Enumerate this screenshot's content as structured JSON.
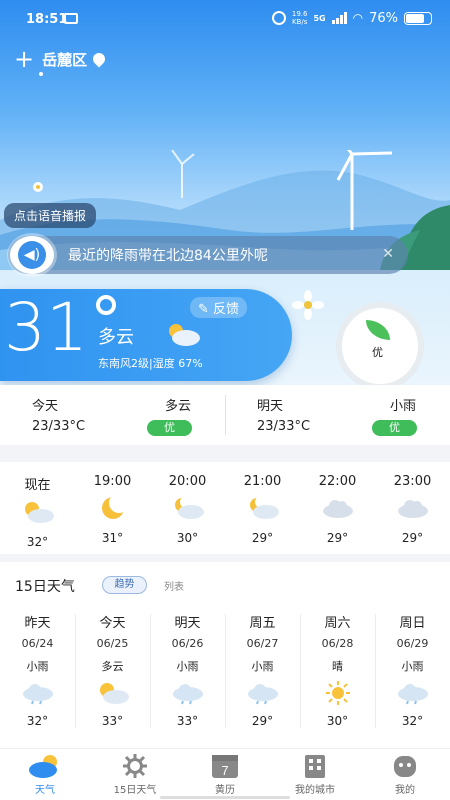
{
  "status": {
    "time": "18:51",
    "network": "19.6\nKB/s",
    "network_top": "19.6",
    "network_bot": "KB/s",
    "cell": "5G",
    "battery": "76%"
  },
  "location": {
    "city": "岳麓区"
  },
  "voice": {
    "tip": "点击语音播报",
    "message": "最近的降雨带在北边84公里外呢"
  },
  "current": {
    "temp": "31",
    "condition": "多云",
    "feedback": "反馈",
    "wind_humidity": "东南风2级|湿度 67%",
    "aqi_label": "优"
  },
  "today": {
    "label": "今天",
    "condition": "多云",
    "range": "23/33°C",
    "aqi": "优"
  },
  "tomorrow": {
    "label": "明天",
    "condition": "小雨",
    "range": "23/33°C",
    "aqi": "优"
  },
  "hourly": [
    {
      "time": "现在",
      "icon": "partly-cloudy-day",
      "temp": "32°"
    },
    {
      "time": "19:00",
      "icon": "moon",
      "temp": "31°"
    },
    {
      "time": "20:00",
      "icon": "partly-cloudy-night",
      "temp": "30°"
    },
    {
      "time": "21:00",
      "icon": "partly-cloudy-night",
      "temp": "29°"
    },
    {
      "time": "22:00",
      "icon": "cloudy",
      "temp": "29°"
    },
    {
      "time": "23:00",
      "icon": "cloudy",
      "temp": "29°"
    }
  ],
  "forecast": {
    "title": "15日天气",
    "tab_trend": "趋势",
    "tab_list": "列表",
    "days": [
      {
        "day": "昨天",
        "date": "06/24",
        "cond": "小雨",
        "icon": "rain",
        "temp": "32°"
      },
      {
        "day": "今天",
        "date": "06/25",
        "cond": "多云",
        "icon": "partly-cloudy-day",
        "temp": "33°"
      },
      {
        "day": "明天",
        "date": "06/26",
        "cond": "小雨",
        "icon": "rain",
        "temp": "33°"
      },
      {
        "day": "周五",
        "date": "06/27",
        "cond": "小雨",
        "icon": "rain",
        "temp": "29°"
      },
      {
        "day": "周六",
        "date": "06/28",
        "cond": "晴",
        "icon": "sunny",
        "temp": "30°"
      },
      {
        "day": "周日",
        "date": "06/29",
        "cond": "小雨",
        "icon": "rain",
        "temp": "32°"
      }
    ]
  },
  "nav": [
    {
      "label": "天气",
      "icon": "weather-icon"
    },
    {
      "label": "15日天气",
      "icon": "sun-icon"
    },
    {
      "label": "黄历",
      "icon": "calendar-icon",
      "badge": "7"
    },
    {
      "label": "我的城市",
      "icon": "city-icon"
    },
    {
      "label": "我的",
      "icon": "profile-icon"
    }
  ],
  "colors": {
    "accent": "#2f8df0",
    "good": "#3ebd5a"
  }
}
